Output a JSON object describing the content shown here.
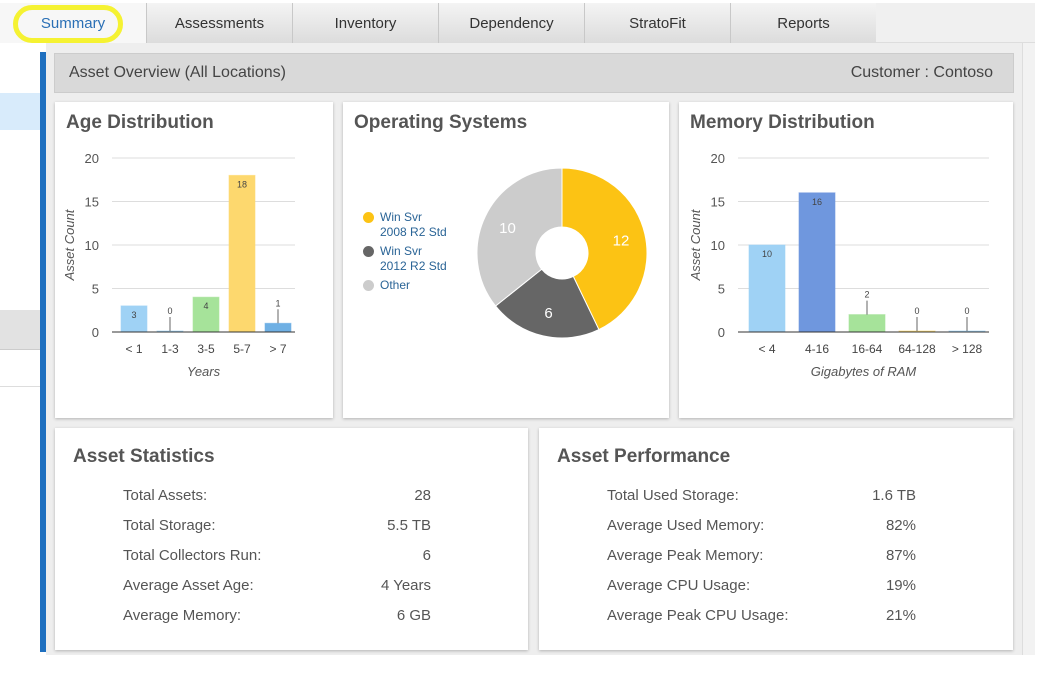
{
  "tabs": [
    "Summary",
    "Assessments",
    "Inventory",
    "Dependency",
    "StratoFit",
    "Reports"
  ],
  "header": {
    "title": "Asset Overview (All Locations)",
    "customer": "Customer : Contoso"
  },
  "age": {
    "title": "Age Distribution"
  },
  "os": {
    "title": "Operating Systems"
  },
  "mem": {
    "title": "Memory Distribution"
  },
  "chart_data": [
    {
      "type": "bar",
      "title": "Age Distribution",
      "categories": [
        "< 1",
        "1-3",
        "3-5",
        "5-7",
        "> 7"
      ],
      "values": [
        3,
        0,
        4,
        18,
        1
      ],
      "colors": [
        "#9fd2f5",
        "#9fd2f5",
        "#a6e39a",
        "#fdd86e",
        "#6fb0e4"
      ],
      "xlabel": "Years",
      "ylabel": "Asset Count",
      "ylim": [
        0,
        20
      ],
      "yticks": [
        "0",
        "5",
        "10",
        "15",
        "20"
      ]
    },
    {
      "type": "pie",
      "title": "Operating Systems",
      "labels": [
        "Win Svr 2008 R2 Std",
        "Win Svr 2012 R2 Std",
        "Other"
      ],
      "legend": [
        [
          "Win Svr",
          "2008 R2 Std"
        ],
        [
          "Win Svr",
          "2012 R2 Std"
        ],
        [
          "Other"
        ]
      ],
      "values": [
        12,
        6,
        10
      ],
      "colors": [
        "#fcc314",
        "#666666",
        "#cccccc"
      ],
      "legend_position": "left"
    },
    {
      "type": "bar",
      "title": "Memory Distribution",
      "categories": [
        "< 4",
        "4-16",
        "16-64",
        "64-128",
        "> 128"
      ],
      "values": [
        10,
        16,
        2,
        0,
        0
      ],
      "colors": [
        "#9fd2f5",
        "#6f97de",
        "#a6e39a",
        "#fdd86e",
        "#9fd2f5"
      ],
      "xlabel": "Gigabytes of RAM",
      "ylabel": "Asset Count",
      "ylim": [
        0,
        20
      ],
      "yticks": [
        "0",
        "5",
        "10",
        "15",
        "20"
      ]
    }
  ],
  "stats": {
    "title": "Asset Statistics",
    "rows": [
      [
        "Total Assets:",
        "28"
      ],
      [
        "Total Storage:",
        "5.5 TB"
      ],
      [
        "Total Collectors Run:",
        "6"
      ],
      [
        "Average Asset Age:",
        "4 Years"
      ],
      [
        "Average Memory:",
        "6 GB"
      ]
    ]
  },
  "perf": {
    "title": "Asset Performance",
    "rows": [
      [
        "Total Used Storage:",
        "1.6 TB"
      ],
      [
        "Average Used Memory:",
        "82%"
      ],
      [
        "Average Peak Memory:",
        "87%"
      ],
      [
        "Average CPU Usage:",
        "19%"
      ],
      [
        "Average Peak CPU Usage:",
        "21%"
      ]
    ]
  }
}
